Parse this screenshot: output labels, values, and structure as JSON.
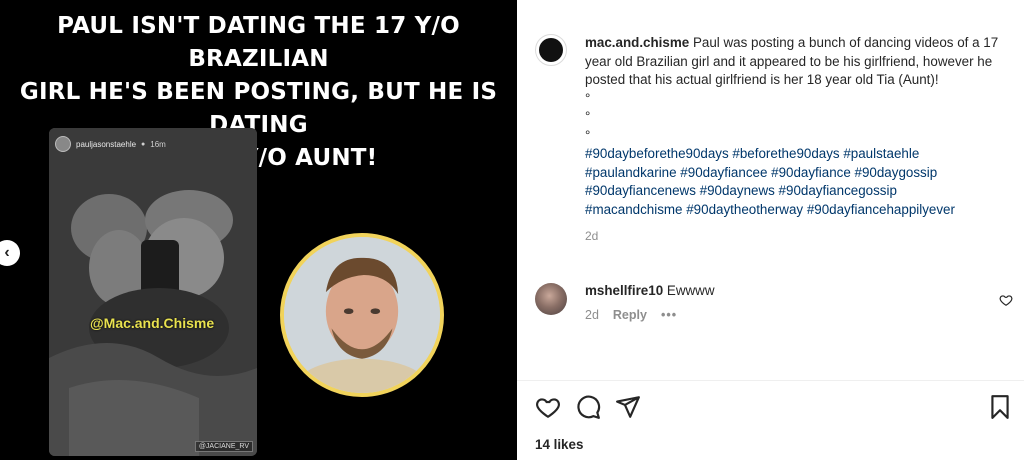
{
  "media": {
    "headline": "PAUL ISN'T DATING THE 17 Y/O BRAZILIAN\nGIRL HE'S BEEN POSTING, BUT HE IS DATING\nHER 18 Y/O AUNT!",
    "story": {
      "username": "pauljasonstaehle",
      "dot": "●",
      "time": "16m",
      "watermark": "@Mac.and.Chisme",
      "tag": "@JACIANE_RV"
    },
    "prev_icon": "chevron-left-icon",
    "prev_glyph": "‹"
  },
  "post": {
    "author": "mac.and.chisme",
    "caption_text": "Paul was posting a bunch of dancing videos of a 17 year old Brazilian girl and it appeared to be his girlfriend, however he posted that his actual girlfriend is her 18 year old Tia (Aunt)!",
    "bullets": [
      "°",
      "°",
      "°"
    ],
    "hashtags": [
      "#90daybeforethe90days #beforethe90days #paulstaehle",
      "#paulandkarine #90dayfiancee #90dayfiance #90daygossip",
      "#90dayfiancenews #90daynews #90dayfiancegossip",
      "#macandchisme #90daytheotherway #90dayfiancehappilyever"
    ],
    "age": "2d",
    "comment": {
      "user": "mshellfire10",
      "text": "Ewwww",
      "age": "2d",
      "reply_label": "Reply",
      "more": "•••"
    },
    "likes": "14 likes"
  },
  "colors": {
    "hashtag": "#00376b",
    "muted": "#8e8e8e",
    "ring": "#f1d35b"
  }
}
